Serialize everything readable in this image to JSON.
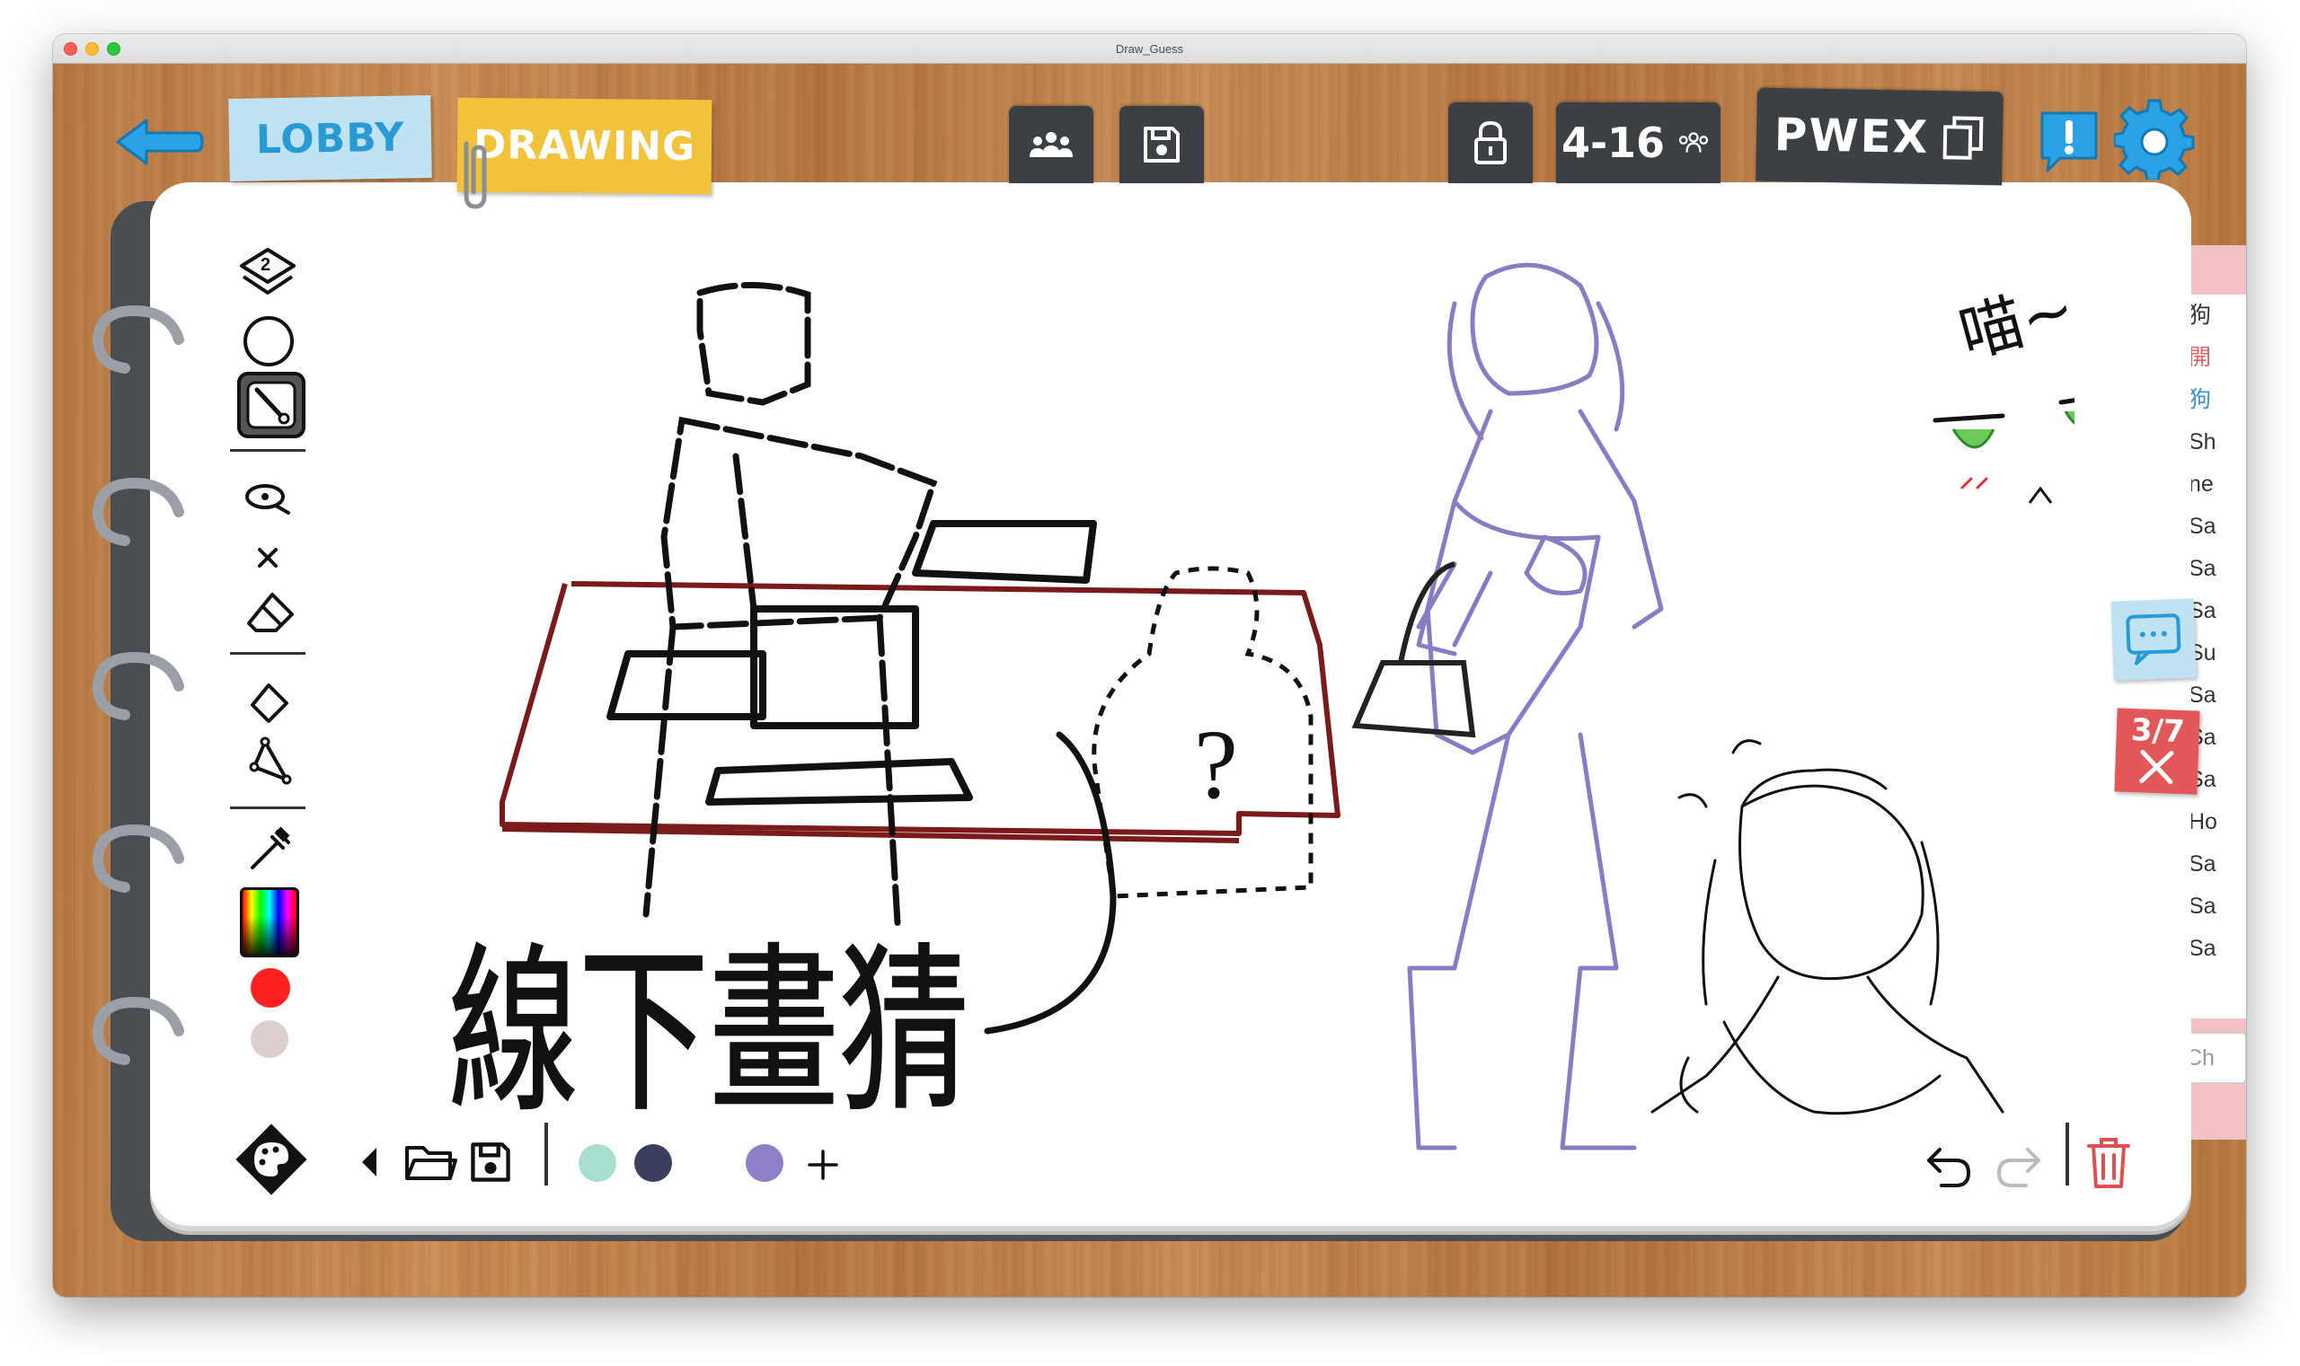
{
  "window": {
    "title": "Draw_Guess"
  },
  "nav": {
    "lobby_label": "LOBBY",
    "drawing_label": "DRAWING"
  },
  "room": {
    "player_range": "4-16",
    "room_code": "PWEX"
  },
  "round": {
    "indicator": "3/7"
  },
  "canvas": {
    "doodle_text_1": "喵~",
    "doodle_text_2": "線下畫猜",
    "doodle_text_3": "?"
  },
  "chat": {
    "messages": [
      "狗",
      "開",
      "狗",
      "Sh",
      "ne",
      "Sa",
      "Sa",
      "Sa",
      "Su",
      "Sa",
      "Sa",
      "Sa",
      "Ho",
      "Sa",
      "Sa",
      "Sa"
    ],
    "message_colors": [
      "#333333",
      "#e06060",
      "#3a8fd6",
      "#333333",
      "#333333",
      "#333333",
      "#333333",
      "#333333",
      "#333333",
      "#333333",
      "#333333",
      "#333333",
      "#333333",
      "#333333",
      "#333333",
      "#333333"
    ],
    "input_placeholder": "Ch"
  },
  "toolbar": {
    "layer_number": "2",
    "palette_colors": [
      "#a8ddd1",
      "#3b3f5c",
      "#8f7fc7"
    ],
    "current_color": "#ff2020",
    "secondary_color": "#dccfcf"
  },
  "icons": {
    "back": "arrow-left-icon",
    "players": "players-icon",
    "save": "save-icon",
    "lock": "lock-icon",
    "copy": "copy-icon",
    "report": "exclamation-icon",
    "settings": "gear-icon"
  }
}
